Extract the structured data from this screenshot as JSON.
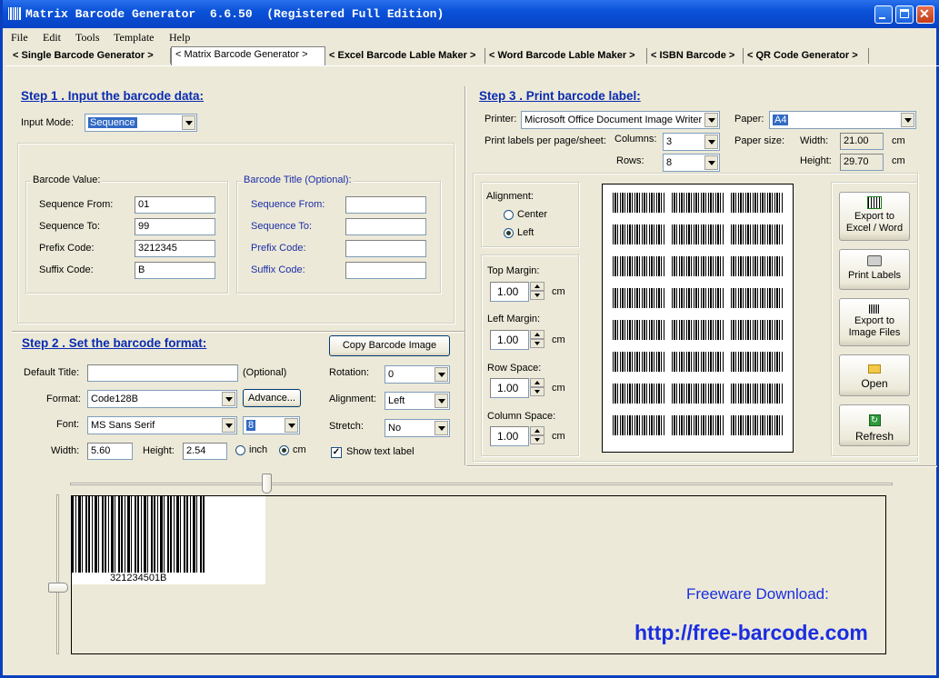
{
  "window": {
    "title": "Matrix Barcode Generator  6.6.50  (Registered Full Edition)"
  },
  "menu": [
    "File",
    "Edit",
    "Tools",
    "Template",
    "Help"
  ],
  "tabs": [
    "< Single Barcode Generator >",
    "< Matrix Barcode Generator >",
    "< Excel Barcode Lable Maker >",
    "< Word Barcode Lable Maker >",
    "< ISBN Barcode >",
    "< QR Code Generator >"
  ],
  "step1": {
    "heading": "Step 1 .  Input the barcode data:",
    "input_mode_label": "Input Mode:",
    "input_mode_value": "Sequence",
    "barcode_value": {
      "title": "Barcode Value:",
      "seq_from_label": "Sequence From:",
      "seq_from": "01",
      "seq_to_label": "Sequence To:",
      "seq_to": "99",
      "prefix_label": "Prefix Code:",
      "prefix": "3212345",
      "suffix_label": "Suffix Code:",
      "suffix": "B"
    },
    "barcode_title": {
      "title": "Barcode Title (Optional):",
      "seq_from_label": "Sequence From:",
      "seq_from": "",
      "seq_to_label": "Sequence To:",
      "seq_to": "",
      "prefix_label": "Prefix Code:",
      "prefix": "",
      "suffix_label": "Suffix Code:",
      "suffix": ""
    }
  },
  "step2": {
    "heading": "Step 2 . Set the barcode format:",
    "copy_button": "Copy Barcode Image",
    "default_title_label": "Default Title:",
    "default_title": "",
    "optional": "(Optional)",
    "format_label": "Format:",
    "format": "Code128B",
    "advance_button": "Advance...",
    "font_label": "Font:",
    "font": "MS Sans Serif",
    "font_size": "8",
    "width_label": "Width:",
    "width": "5.60",
    "height_label": "Height:",
    "height": "2.54",
    "unit_inch": "inch",
    "unit_cm": "cm",
    "rotation_label": "Rotation:",
    "rotation": "0",
    "alignment_label": "Alignment:",
    "alignment": "Left",
    "stretch_label": "Stretch:",
    "stretch": "No",
    "show_text_label": "Show text label"
  },
  "step3": {
    "heading": "Step 3 . Print barcode label:",
    "printer_label": "Printer:",
    "printer": "Microsoft Office Document Image Writer",
    "paper_label": "Paper:",
    "paper": "A4",
    "per_page_label": "Print labels per page/sheet:",
    "columns_label": "Columns:",
    "columns": "3",
    "rows_label": "Rows:",
    "rows": "8",
    "paper_size_label": "Paper size:",
    "width_label": "Width:",
    "width": "21.00",
    "width_unit": "cm",
    "height_label": "Height:",
    "height": "29.70",
    "height_unit": "cm",
    "alignment_title": "Alignment:",
    "align_center": "Center",
    "align_left": "Left",
    "top_margin_label": "Top Margin:",
    "top_margin": "1.00",
    "left_margin_label": "Left Margin:",
    "left_margin": "1.00",
    "row_space_label": "Row Space:",
    "row_space": "1.00",
    "column_space_label": "Column Space:",
    "column_space": "1.00",
    "unit": "cm"
  },
  "actions": {
    "export_excel": "Export to\nExcel / Word",
    "print_labels": "Print Labels",
    "export_image": "Export to\nImage Files",
    "open": "Open",
    "refresh": "Refresh"
  },
  "preview": {
    "barcode_text": "321234501B",
    "freeware": "Freeware Download:",
    "url": "http://free-barcode.com"
  },
  "colors": {
    "heading": "#0a2bb0",
    "link": "#1a2ee0",
    "titlebar": "#0a52d9"
  }
}
